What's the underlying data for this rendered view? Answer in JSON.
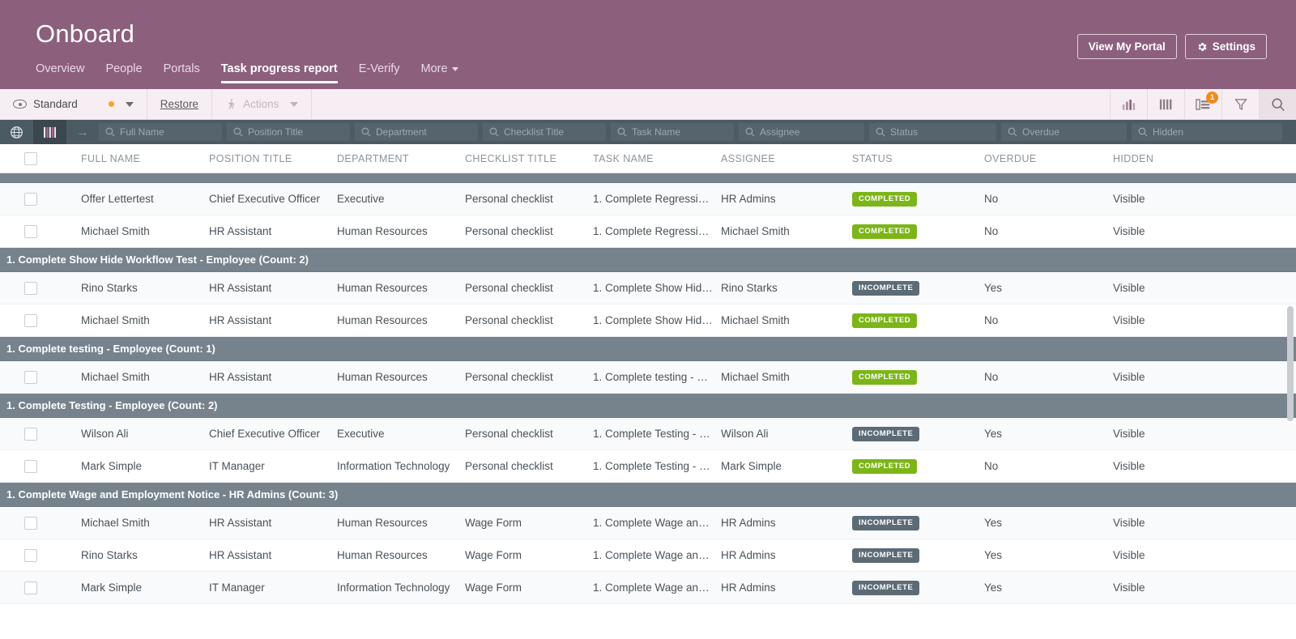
{
  "header": {
    "title": "Onboard",
    "nav": [
      {
        "label": "Overview",
        "active": false,
        "caret": false
      },
      {
        "label": "People",
        "active": false,
        "caret": false
      },
      {
        "label": "Portals",
        "active": false,
        "caret": false
      },
      {
        "label": "Task progress report",
        "active": true,
        "caret": false
      },
      {
        "label": "E-Verify",
        "active": false,
        "caret": false
      },
      {
        "label": "More",
        "active": false,
        "caret": true
      }
    ],
    "view_portal_label": "View My Portal",
    "settings_label": "Settings",
    "brand_color": "#8c5f7d"
  },
  "toolbar": {
    "view_label": "Standard",
    "restore_label": "Restore",
    "actions_label": "Actions",
    "group_badge_count": "1",
    "icons": [
      {
        "name": "chart-icon"
      },
      {
        "name": "columns-icon"
      },
      {
        "name": "group-icon"
      },
      {
        "name": "filter-icon"
      },
      {
        "name": "search-icon"
      }
    ]
  },
  "filter_row": {
    "placeholders": [
      "Full Name",
      "Position Title",
      "Department",
      "Checklist Title",
      "Task Name",
      "Assignee",
      "Status",
      "Overdue",
      "Hidden"
    ],
    "values": [
      "",
      "",
      "",
      "",
      "",
      "",
      "",
      "",
      ""
    ]
  },
  "grid": {
    "columns": [
      "FULL NAME",
      "POSITION TITLE",
      "DEPARTMENT",
      "CHECKLIST TITLE",
      "TASK NAME",
      "ASSIGNEE",
      "STATUS",
      "OVERDUE",
      "HIDDEN"
    ],
    "rows": [
      {
        "type": "group",
        "label": "",
        "clipped": true
      },
      {
        "type": "data",
        "stripe": "alt",
        "full_name": "Offer Lettertest",
        "position_title": "Chief Executive Officer",
        "department": "Executive",
        "checklist_title": "Personal checklist",
        "task_name": "1. Complete Regression …",
        "assignee": "HR Admins",
        "status": "COMPLETED",
        "status_kind": "completed",
        "overdue": "No",
        "hidden": "Visible"
      },
      {
        "type": "data",
        "stripe": "white",
        "full_name": "Michael Smith",
        "position_title": "HR Assistant",
        "department": "Human Resources",
        "checklist_title": "Personal checklist",
        "task_name": "1. Complete Regression …",
        "assignee": "Michael Smith",
        "status": "COMPLETED",
        "status_kind": "completed",
        "overdue": "No",
        "hidden": "Visible"
      },
      {
        "type": "group",
        "label": "1. Complete Show Hide Workflow Test - Employee (Count: 2)",
        "clipped": false
      },
      {
        "type": "data",
        "stripe": "alt",
        "full_name": "Rino Starks",
        "position_title": "HR Assistant",
        "department": "Human Resources",
        "checklist_title": "Personal checklist",
        "task_name": "1. Complete Show Hide …",
        "assignee": "Rino Starks",
        "status": "INCOMPLETE",
        "status_kind": "incomplete",
        "overdue": "Yes",
        "hidden": "Visible"
      },
      {
        "type": "data",
        "stripe": "white",
        "full_name": "Michael Smith",
        "position_title": "HR Assistant",
        "department": "Human Resources",
        "checklist_title": "Personal checklist",
        "task_name": "1. Complete Show Hide …",
        "assignee": "Michael Smith",
        "status": "COMPLETED",
        "status_kind": "completed",
        "overdue": "No",
        "hidden": "Visible"
      },
      {
        "type": "group",
        "label": "1. Complete testing - Employee (Count: 1)",
        "clipped": false
      },
      {
        "type": "data",
        "stripe": "alt",
        "full_name": "Michael Smith",
        "position_title": "HR Assistant",
        "department": "Human Resources",
        "checklist_title": "Personal checklist",
        "task_name": "1. Complete testing - Em…",
        "assignee": "Michael Smith",
        "status": "COMPLETED",
        "status_kind": "completed",
        "overdue": "No",
        "hidden": "Visible"
      },
      {
        "type": "group",
        "label": "1. Complete Testing - Employee (Count: 2)",
        "clipped": false
      },
      {
        "type": "data",
        "stripe": "alt",
        "full_name": "Wilson Ali",
        "position_title": "Chief Executive Officer",
        "department": "Executive",
        "checklist_title": "Personal checklist",
        "task_name": "1. Complete Testing - Em…",
        "assignee": "Wilson Ali",
        "status": "INCOMPLETE",
        "status_kind": "incomplete",
        "overdue": "Yes",
        "hidden": "Visible"
      },
      {
        "type": "data",
        "stripe": "white",
        "full_name": "Mark Simple",
        "position_title": "IT Manager",
        "department": "Information Technology",
        "checklist_title": "Personal checklist",
        "task_name": "1. Complete Testing - Em…",
        "assignee": "Mark Simple",
        "status": "COMPLETED",
        "status_kind": "completed",
        "overdue": "No",
        "hidden": "Visible"
      },
      {
        "type": "group",
        "label": "1. Complete Wage and Employment Notice - HR Admins (Count: 3)",
        "clipped": false
      },
      {
        "type": "data",
        "stripe": "alt",
        "full_name": "Michael Smith",
        "position_title": "HR Assistant",
        "department": "Human Resources",
        "checklist_title": "Wage Form",
        "task_name": "1. Complete Wage and E…",
        "assignee": "HR Admins",
        "status": "INCOMPLETE",
        "status_kind": "incomplete",
        "overdue": "Yes",
        "hidden": "Visible"
      },
      {
        "type": "data",
        "stripe": "white",
        "full_name": "Rino Starks",
        "position_title": "HR Assistant",
        "department": "Human Resources",
        "checklist_title": "Wage Form",
        "task_name": "1. Complete Wage and E…",
        "assignee": "HR Admins",
        "status": "INCOMPLETE",
        "status_kind": "incomplete",
        "overdue": "Yes",
        "hidden": "Visible"
      },
      {
        "type": "data",
        "stripe": "alt",
        "full_name": "Mark Simple",
        "position_title": "IT Manager",
        "department": "Information Technology",
        "checklist_title": "Wage Form",
        "task_name": "1. Complete Wage and E…",
        "assignee": "HR Admins",
        "status": "INCOMPLETE",
        "status_kind": "incomplete",
        "overdue": "Yes",
        "hidden": "Visible"
      }
    ]
  },
  "colors": {
    "brand": "#8c5f7d",
    "group_band": "#76838c",
    "filter_bar": "#4c5a63",
    "badge_completed": "#7cb518",
    "badge_incomplete": "#5c6b75",
    "badge_count": "#f08a1c"
  }
}
